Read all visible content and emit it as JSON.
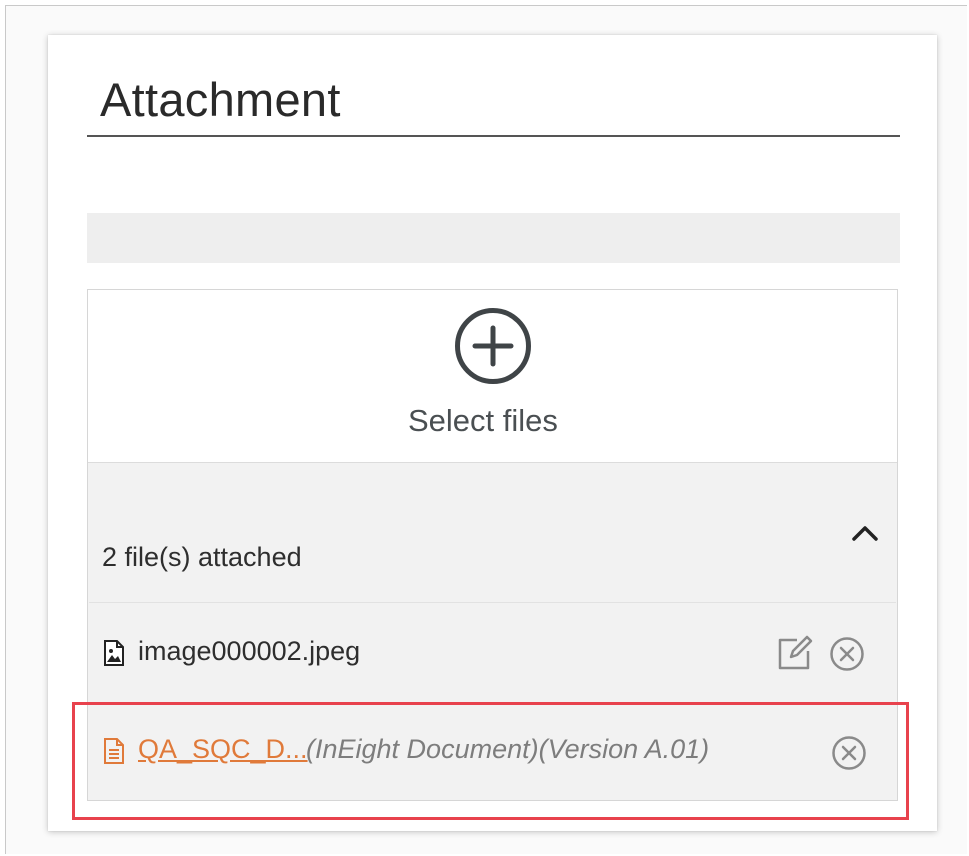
{
  "panel": {
    "title": "Attachment"
  },
  "uploader": {
    "select_label": "Select files"
  },
  "attachments": {
    "count_label": "2 file(s) attached",
    "files": [
      {
        "name": "image000002.jpeg",
        "type_icon": "image-file-icon",
        "actions": [
          "edit-icon",
          "remove-icon"
        ]
      },
      {
        "name": "QA_SQC_D...",
        "meta": "(InEight Document)(Version A.01)",
        "type_icon": "document-file-icon",
        "link_color": "#e07a3a",
        "actions": [
          "remove-icon"
        ],
        "highlighted": true
      }
    ]
  },
  "colors": {
    "highlight": "#e8424d",
    "link": "#e07a3a",
    "icon": "#4a4f52"
  }
}
